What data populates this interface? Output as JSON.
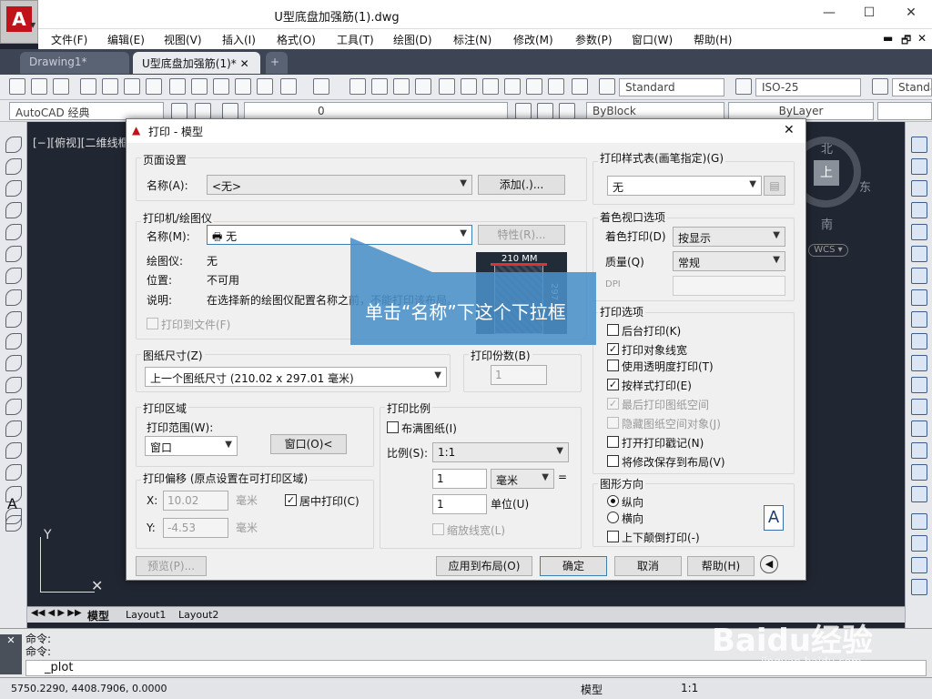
{
  "app": {
    "file_title": "U型底盘加强筋(1).dwg"
  },
  "window": {
    "min": "—",
    "max": "☐",
    "close": "✕",
    "sub_min": "▬",
    "sub_restore": "🗗",
    "sub_close": "✕"
  },
  "menu": [
    "文件(F)",
    "编辑(E)",
    "视图(V)",
    "插入(I)",
    "格式(O)",
    "工具(T)",
    "绘图(D)",
    "标注(N)",
    "修改(M)",
    "参数(P)",
    "窗口(W)",
    "帮助(H)"
  ],
  "tabs": [
    {
      "label": "Drawing1*"
    },
    {
      "label": "U型底盘加强筋(1)*"
    }
  ],
  "toolbar": {
    "text_style": "Standard",
    "dim_style": "ISO-25",
    "table_style": "Standa",
    "workspace": "AutoCAD 经典",
    "layer": "0",
    "color": "ByBlock",
    "linetype": "ByLayer"
  },
  "canvas": {
    "view_label": "[−][俯视][二维线框]",
    "north": "北",
    "east": "东",
    "south": "南",
    "top": "上",
    "wcs": "WCS ▾",
    "axis_y": "Y"
  },
  "layout_tabs": [
    "模型",
    "Layout1",
    "Layout2"
  ],
  "command": {
    "line1": "命令:",
    "line2": "命令:",
    "input": "_plot"
  },
  "status": {
    "coords": "5750.2290, 4408.7906, 0.0000",
    "model": "模型",
    "scale": "1:1"
  },
  "dialog": {
    "title": "打印 - 模型",
    "page_setup": {
      "label": "页面设置",
      "name_label": "名称(A):",
      "name_value": "<无>",
      "add_button": "添加(.)..."
    },
    "printer": {
      "label": "打印机/绘图仪",
      "name_label": "名称(M):",
      "name_value": "无",
      "props_button": "特性(R)...",
      "plotter_label": "绘图仪:",
      "plotter_value": "无",
      "location_label": "位置:",
      "location_value": "不可用",
      "desc_label": "说明:",
      "desc_value": "在选择新的绘图仪配置名称之前，不能打印该布局。",
      "print_to_file": "打印到文件(F)"
    },
    "preview": {
      "width_label": "210 MM",
      "height_label": "297"
    },
    "paper": {
      "label": "图纸尺寸(Z)",
      "value": "上一个图纸尺寸 (210.02 x 297.01 毫米)"
    },
    "copies": {
      "label": "打印份数(B)",
      "value": "1"
    },
    "area": {
      "label": "打印区域",
      "range_label": "打印范围(W):",
      "range_value": "窗口",
      "window_button": "窗口(O)<"
    },
    "offset": {
      "label": "打印偏移 (原点设置在可打印区域)",
      "x_label": "X:",
      "x_value": "10.02",
      "x_unit": "毫米",
      "y_label": "Y:",
      "y_value": "-4.53",
      "y_unit": "毫米",
      "center": "居中打印(C)"
    },
    "scale": {
      "label": "打印比例",
      "fit": "布满图纸(I)",
      "scale_label": "比例(S):",
      "scale_value": "1:1",
      "val1": "1",
      "unit1": "毫米",
      "eq": "=",
      "val2": "1",
      "unit2": "单位(U)",
      "lineweights": "缩放线宽(L)"
    },
    "style_table": {
      "label": "打印样式表(画笔指定)(G)",
      "value": "无"
    },
    "shaded": {
      "label": "着色视口选项",
      "shade_label": "着色打印(D)",
      "shade_value": "按显示",
      "quality_label": "质量(Q)",
      "quality_value": "常规",
      "dpi_label": "DPI"
    },
    "options": {
      "label": "打印选项",
      "items": [
        {
          "label": "后台打印(K)",
          "checked": false,
          "enabled": true
        },
        {
          "label": "打印对象线宽",
          "checked": true,
          "enabled": true
        },
        {
          "label": "使用透明度打印(T)",
          "checked": false,
          "enabled": true
        },
        {
          "label": "按样式打印(E)",
          "checked": true,
          "enabled": true
        },
        {
          "label": "最后打印图纸空间",
          "checked": true,
          "enabled": false
        },
        {
          "label": "隐藏图纸空间对象(J)",
          "checked": false,
          "enabled": false
        },
        {
          "label": "打开打印戳记(N)",
          "checked": false,
          "enabled": true
        },
        {
          "label": "将修改保存到布局(V)",
          "checked": false,
          "enabled": true
        }
      ]
    },
    "orientation": {
      "label": "图形方向",
      "portrait": "纵向",
      "landscape": "横向",
      "upside": "上下颠倒打印(-)",
      "icon": "A"
    },
    "buttons": {
      "preview": "预览(P)...",
      "apply": "应用到布局(O)",
      "ok": "确定",
      "cancel": "取消",
      "help": "帮助(H)",
      "more": "◀"
    },
    "callout": "单击“名称”下这个下拉框"
  },
  "watermark": {
    "logo": "Baidu经验",
    "url": "jingyan.baidu.com"
  }
}
